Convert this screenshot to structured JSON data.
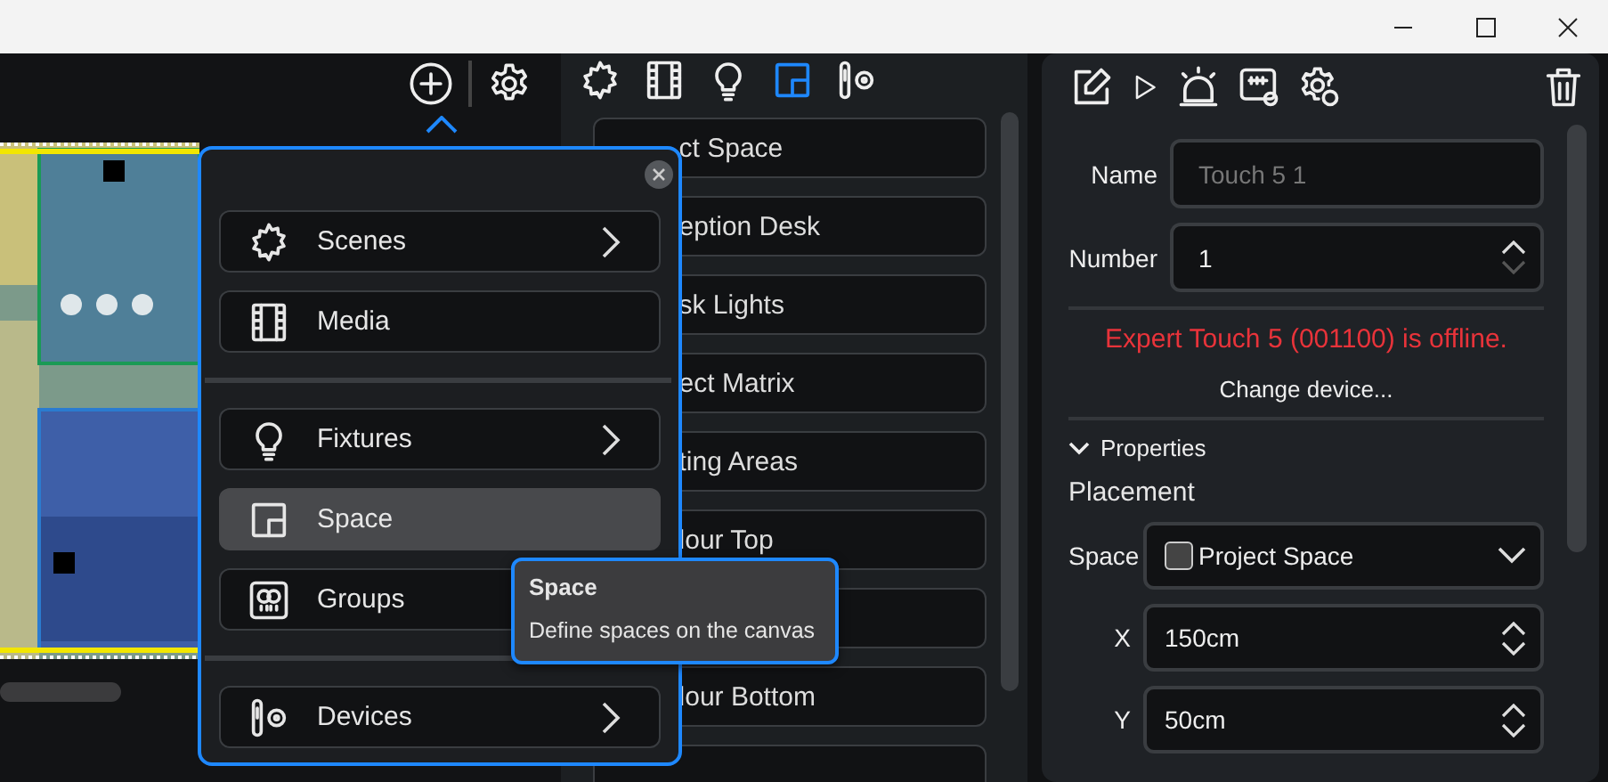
{
  "list_tabs": [
    {
      "kind": "scenes",
      "selected": false
    },
    {
      "kind": "media",
      "selected": false
    },
    {
      "kind": "fixtures",
      "selected": false
    },
    {
      "kind": "space",
      "selected": true
    },
    {
      "kind": "devices",
      "selected": false
    }
  ],
  "list_items": [
    {
      "kind": "row",
      "label": "ct Space"
    },
    {
      "kind": "row",
      "label": "eption Desk"
    },
    {
      "kind": "row",
      "label": "sk Lights"
    },
    {
      "kind": "row",
      "label": "ect Matrix"
    },
    {
      "kind": "row",
      "label": "ting Areas"
    },
    {
      "kind": "row",
      "label": "lour Top"
    },
    {
      "kind": "row"
    },
    {
      "kind": "row",
      "label": "lour Bottom"
    },
    {
      "kind": "row"
    }
  ],
  "add_menu": {
    "groups": [
      {
        "items": [
          {
            "kind": "scenes",
            "label": "Scenes",
            "submenu": true,
            "selected": false
          },
          {
            "kind": "media",
            "label": "Media",
            "submenu": false,
            "selected": false
          }
        ]
      },
      {
        "items": [
          {
            "kind": "fixtures",
            "label": "Fixtures",
            "submenu": true,
            "selected": false
          },
          {
            "kind": "space",
            "label": "Space",
            "submenu": false,
            "selected": true
          },
          {
            "kind": "groups",
            "label": "Groups",
            "submenu": false,
            "selected": false
          }
        ]
      },
      {
        "items": [
          {
            "kind": "devices",
            "label": "Devices",
            "submenu": true,
            "selected": false
          }
        ]
      }
    ]
  },
  "tooltip": {
    "title": "Space",
    "text": "Define spaces on the canvas"
  },
  "inspector": {
    "name": {
      "label": "Name",
      "placeholder": "Touch 5 1"
    },
    "number": {
      "label": "Number",
      "value": "1",
      "decrement_disabled": true
    },
    "status": "Expert Touch 5 (001100) is offline.",
    "change_device": "Change device...",
    "properties": {
      "label": "Properties",
      "expanded": true
    },
    "section": "Placement",
    "space": {
      "label": "Space",
      "value": "Project Space"
    },
    "coords": [
      {
        "label": "X",
        "value": "150cm",
        "decrement_disabled": false
      },
      {
        "label": "Y",
        "value": "50cm",
        "decrement_disabled": false
      }
    ]
  }
}
